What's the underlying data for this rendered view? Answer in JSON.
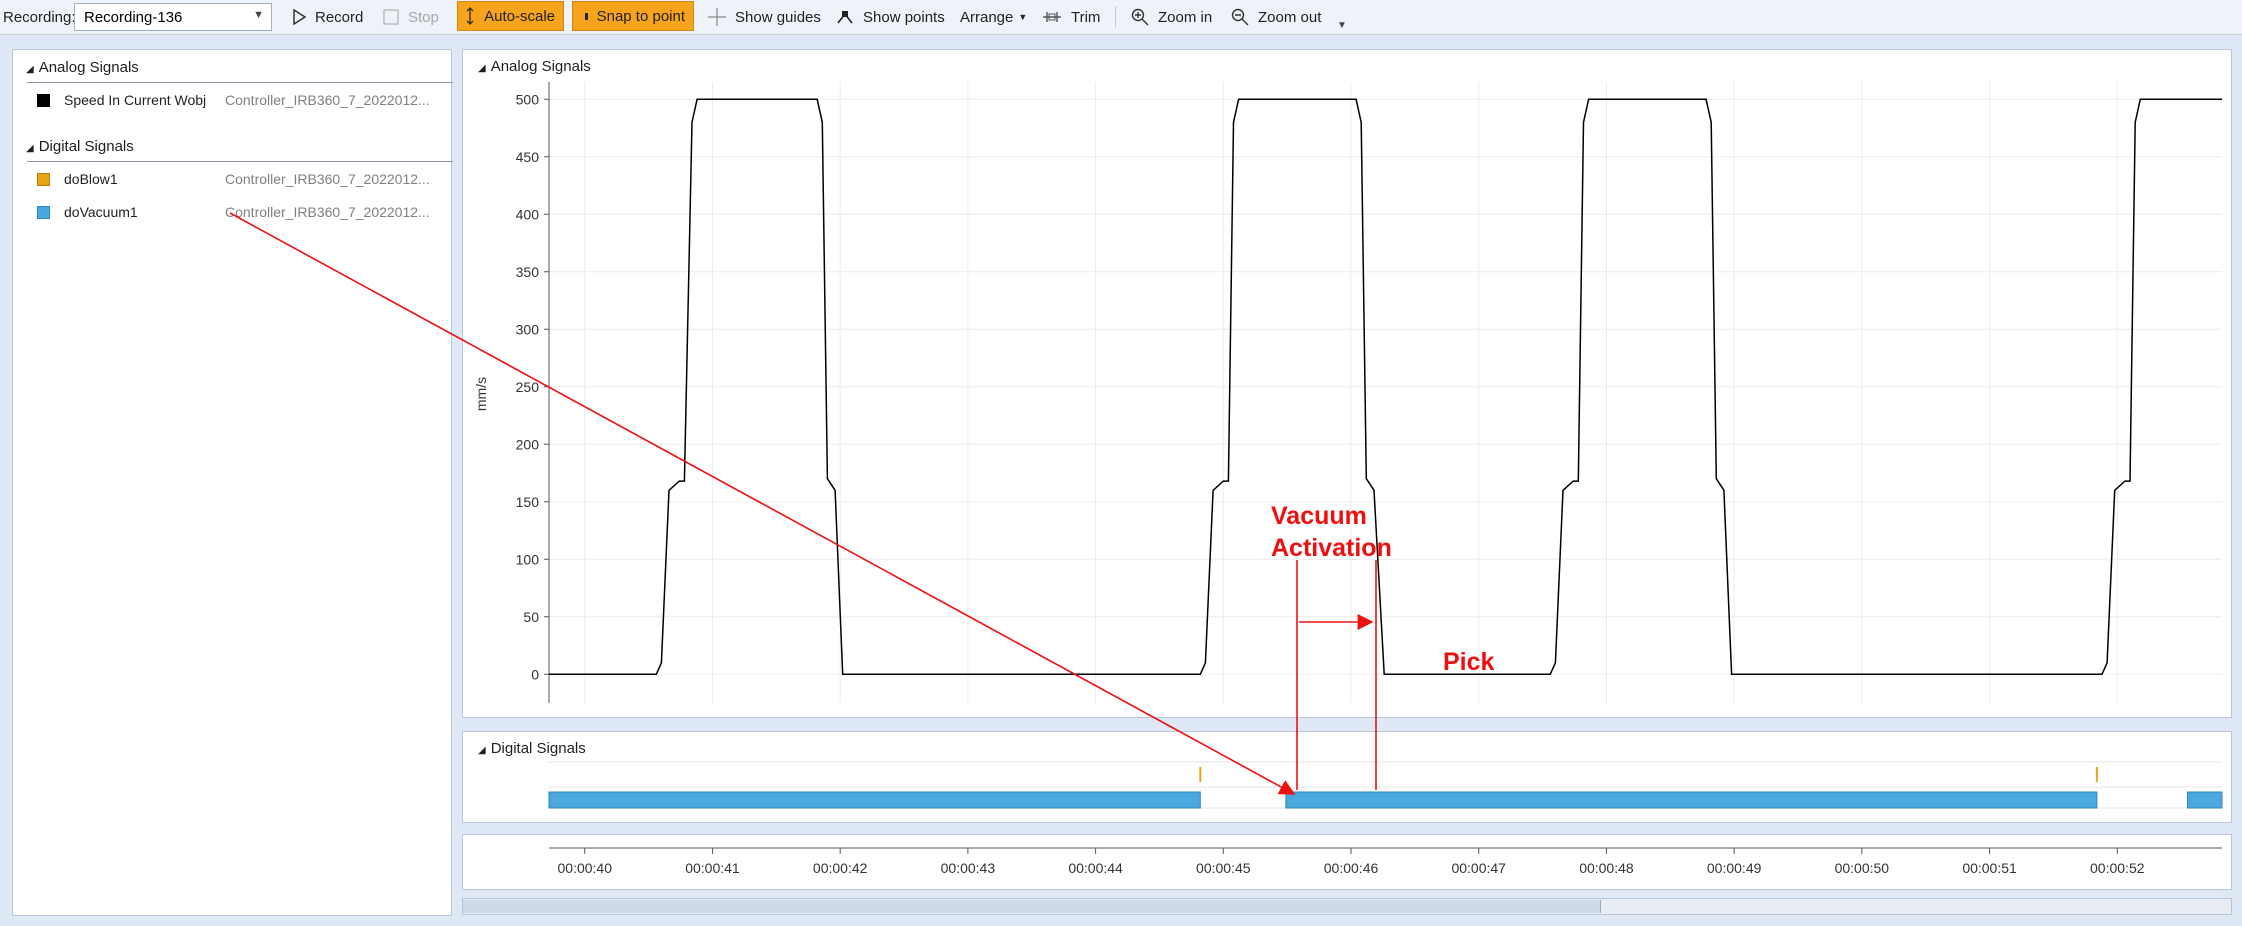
{
  "toolbar": {
    "recording_label": "Recording:",
    "recording_value": "Recording-136",
    "record": "Record",
    "stop": "Stop",
    "auto_scale": "Auto-scale",
    "snap_to_point": "Snap to point",
    "show_guides": "Show guides",
    "show_points": "Show points",
    "arrange": "Arrange",
    "trim": "Trim",
    "zoom_in": "Zoom in",
    "zoom_out": "Zoom out"
  },
  "signals_panel": {
    "analog_header": "Analog Signals",
    "analog": [
      {
        "name": "Speed In Current Wobj",
        "controller": "Controller_IRB360_7_2022012...",
        "color": "#000000"
      }
    ],
    "digital_header": "Digital Signals",
    "digital": [
      {
        "name": "doBlow1",
        "controller": "Controller_IRB360_7_2022012...",
        "color": "#e8a317"
      },
      {
        "name": "doVacuum1",
        "controller": "Controller_IRB360_7_2022012...",
        "color": "#4aa8dc"
      }
    ]
  },
  "analog_chart": {
    "header": "Analog Signals",
    "ylabel": "mm/s",
    "yticks": [
      "0",
      "50",
      "100",
      "150",
      "200",
      "250",
      "300",
      "350",
      "400",
      "450",
      "500"
    ]
  },
  "digital_chart": {
    "header": "Digital Signals"
  },
  "time_axis": {
    "ticks": [
      "00:00:40",
      "00:00:41",
      "00:00:42",
      "00:00:43",
      "00:00:44",
      "00:00:45",
      "00:00:46",
      "00:00:47",
      "00:00:48",
      "00:00:49",
      "00:00:50",
      "00:00:51",
      "00:00:52"
    ]
  },
  "annotations": {
    "vacuum_activation_line1": "Vacuum",
    "vacuum_activation_line2": "Activation",
    "pick": "Pick",
    "color": "#ee1010"
  },
  "chart_data": {
    "type": "line",
    "title": "Analog Signals",
    "xlabel": "",
    "ylabel": "mm/s",
    "xlim": [
      "00:00:39.72",
      "00:00:52.82"
    ],
    "ylim": [
      -25,
      515
    ],
    "grid": true,
    "series": [
      {
        "name": "Speed In Current Wobj",
        "color": "#000000",
        "points": [
          [
            39.72,
            0
          ],
          [
            40.56,
            0
          ],
          [
            40.6,
            10
          ],
          [
            40.66,
            160
          ],
          [
            40.74,
            168
          ],
          [
            40.78,
            168
          ],
          [
            40.84,
            480
          ],
          [
            40.88,
            500
          ],
          [
            41.82,
            500
          ],
          [
            41.86,
            480
          ],
          [
            41.9,
            170
          ],
          [
            41.96,
            160
          ],
          [
            42.02,
            0
          ],
          [
            44.82,
            0
          ],
          [
            44.86,
            10
          ],
          [
            44.92,
            160
          ],
          [
            45.0,
            168
          ],
          [
            45.04,
            168
          ],
          [
            45.08,
            480
          ],
          [
            45.12,
            500
          ],
          [
            46.04,
            500
          ],
          [
            46.08,
            480
          ],
          [
            46.12,
            170
          ],
          [
            46.18,
            160
          ],
          [
            46.26,
            0
          ],
          [
            47.56,
            0
          ],
          [
            47.6,
            10
          ],
          [
            47.66,
            160
          ],
          [
            47.74,
            168
          ],
          [
            47.78,
            168
          ],
          [
            47.82,
            480
          ],
          [
            47.86,
            500
          ],
          [
            48.78,
            500
          ],
          [
            48.82,
            480
          ],
          [
            48.86,
            170
          ],
          [
            48.92,
            160
          ],
          [
            48.98,
            0
          ],
          [
            51.88,
            0
          ],
          [
            51.92,
            10
          ],
          [
            51.98,
            160
          ],
          [
            52.06,
            168
          ],
          [
            52.1,
            168
          ],
          [
            52.14,
            480
          ],
          [
            52.18,
            500
          ],
          [
            52.82,
            500
          ]
        ]
      }
    ],
    "digital_series": [
      {
        "name": "doVacuum1",
        "color": "#4aa8dc",
        "on_intervals": [
          [
            39.72,
            44.82
          ],
          [
            45.49,
            51.84
          ],
          [
            52.55,
            52.82
          ]
        ]
      },
      {
        "name": "doBlow1",
        "color": "#e8a317",
        "pulses": [
          44.82,
          51.84
        ]
      }
    ]
  }
}
